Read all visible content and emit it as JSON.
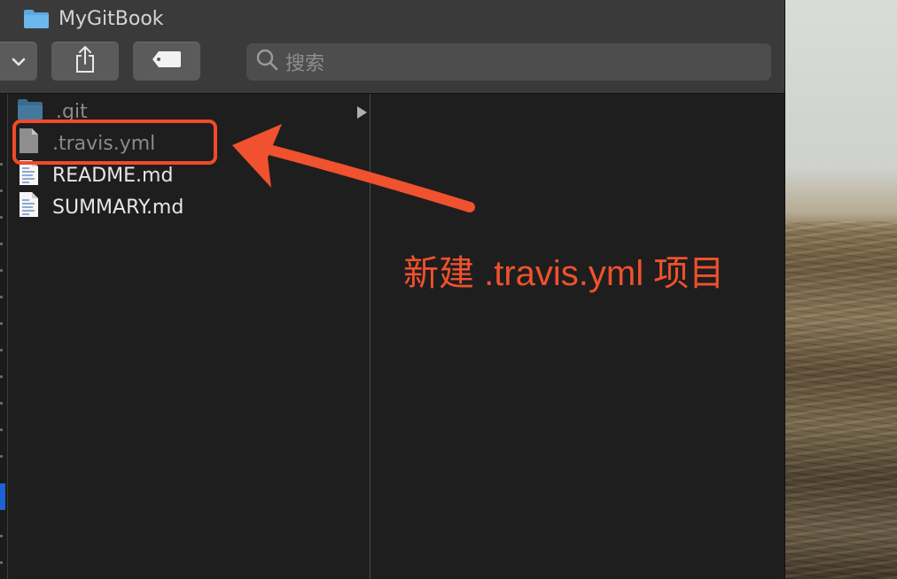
{
  "window": {
    "title": "MyGitBook",
    "folder_icon": "folder-icon"
  },
  "toolbar": {
    "view_dropdown_icon": "chevron-down-icon",
    "share_icon": "share-icon",
    "tag_icon": "tag-icon",
    "search_placeholder": "搜索",
    "search_icon": "search-icon"
  },
  "files": [
    {
      "name": ".git",
      "kind": "folder",
      "hidden": true
    },
    {
      "name": ".travis.yml",
      "kind": "file",
      "hidden": true
    },
    {
      "name": "README.md",
      "kind": "text-file",
      "hidden": false
    },
    {
      "name": "SUMMARY.md",
      "kind": "text-file",
      "hidden": false
    }
  ],
  "annotation": {
    "text": "新建 .travis.yml 项目",
    "color": "#f0512e"
  },
  "colors": {
    "accent_red": "#f04a2a",
    "selection_blue": "#1d62d6"
  }
}
